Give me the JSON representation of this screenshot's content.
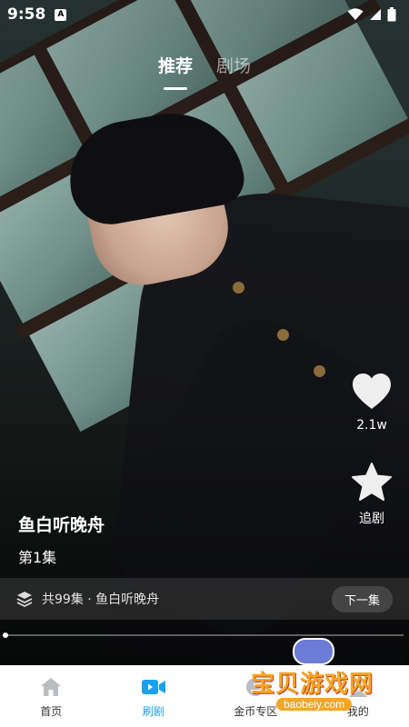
{
  "status_bar": {
    "time": "9:58",
    "badge": "A"
  },
  "top_tabs": [
    {
      "label": "推荐",
      "active": true
    },
    {
      "label": "剧场",
      "active": false
    }
  ],
  "actions": {
    "like_count": "2.1w",
    "follow_label": "追剧"
  },
  "drama": {
    "title": "鱼白听晚舟",
    "episode": "第1集",
    "series_info": "共99集 · 鱼白听晚舟",
    "next_label": "下一集"
  },
  "playback": {
    "progress": 0.0
  },
  "bottom_nav": [
    {
      "label": "首页",
      "icon": "home-icon",
      "active": false
    },
    {
      "label": "刷剧",
      "icon": "video-icon",
      "active": true
    },
    {
      "label": "金币专区",
      "icon": "coin-icon",
      "active": false
    },
    {
      "label": "我的",
      "icon": "profile-icon",
      "active": false
    }
  ],
  "watermark": {
    "text": "宝贝游戏网",
    "url": "baobeiy.com"
  },
  "colors": {
    "accent": "#1aa0f0",
    "watermark": "#f5a623"
  }
}
